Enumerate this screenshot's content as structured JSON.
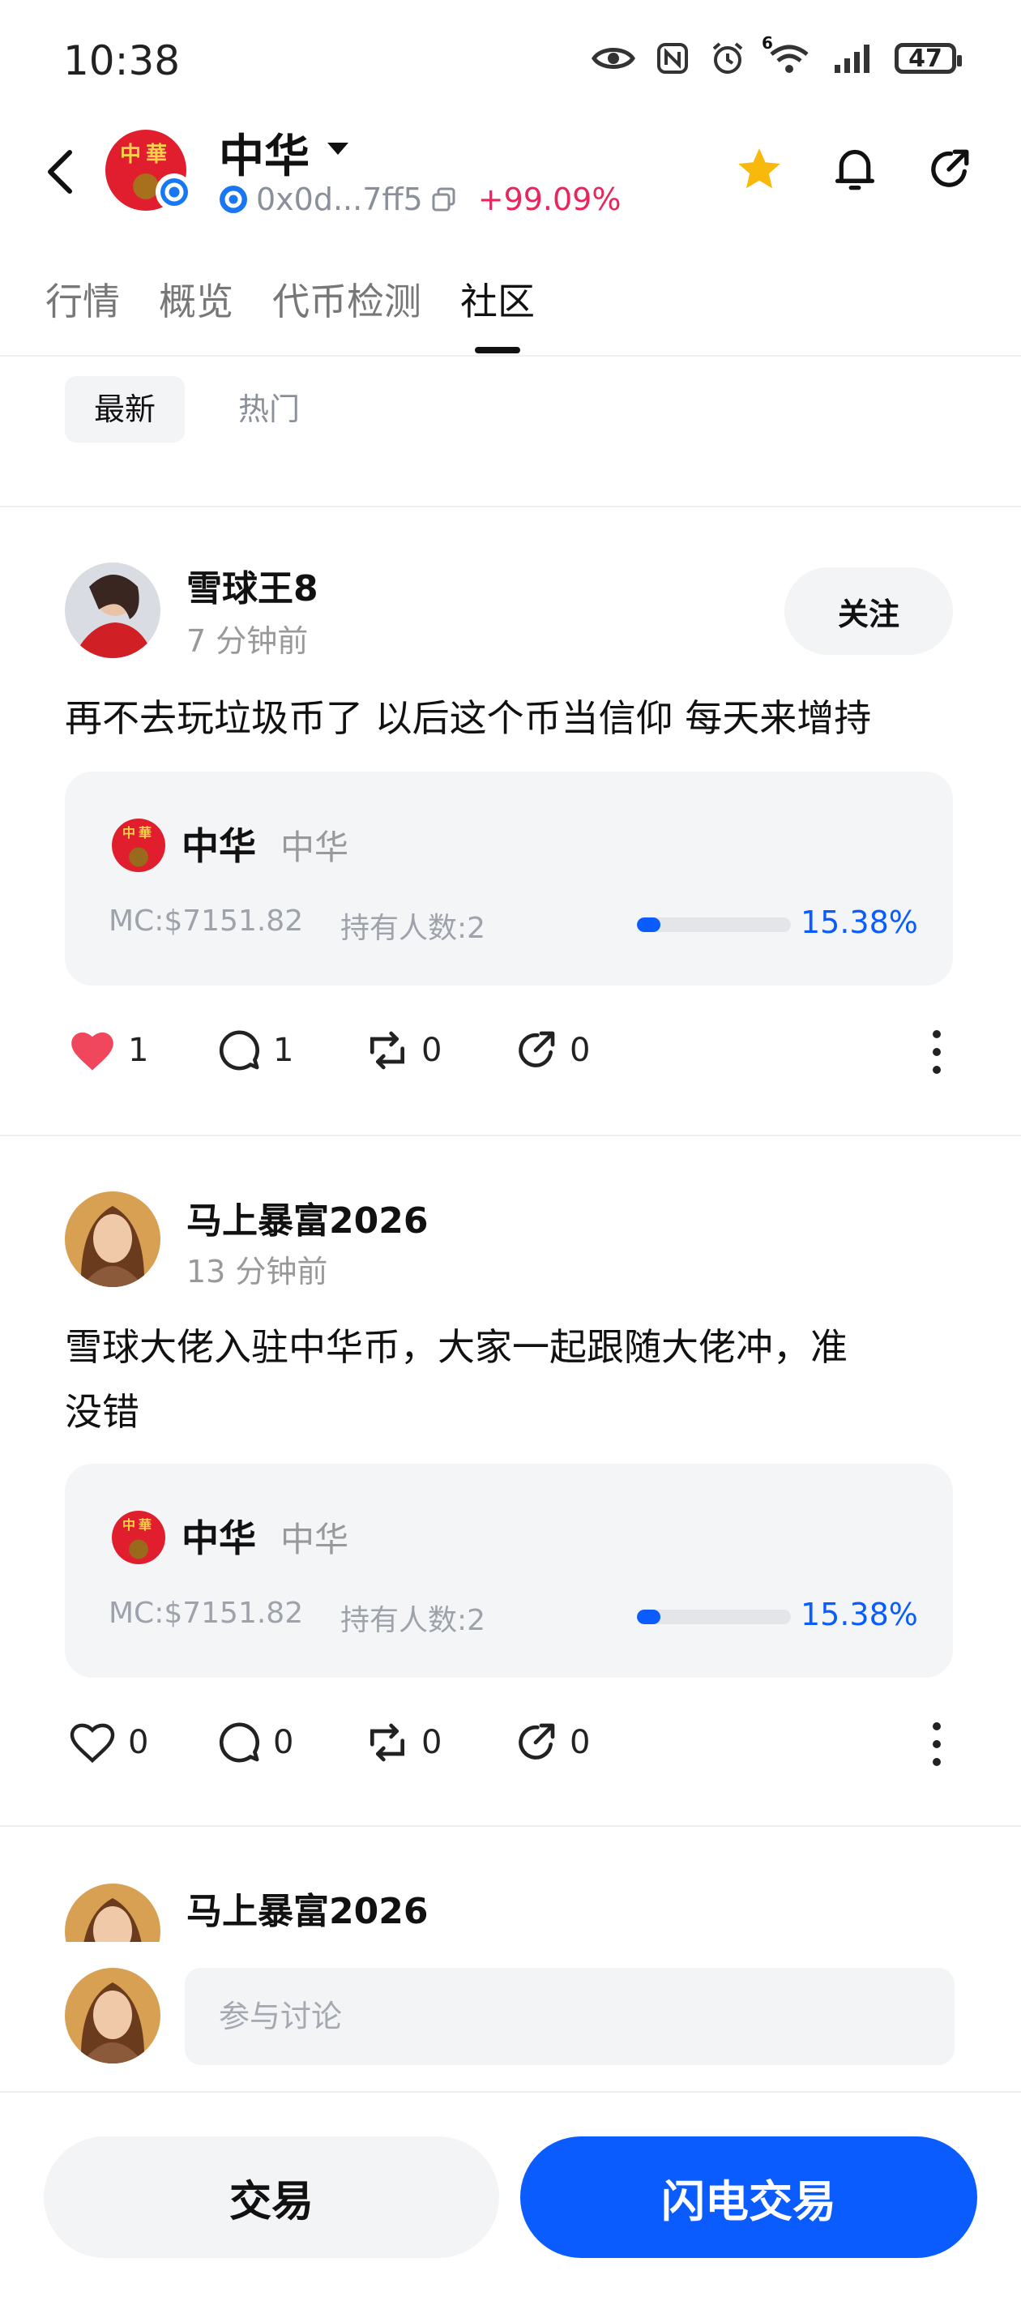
{
  "status_bar": {
    "time": "10:38",
    "battery": "47",
    "wifi_badge": "6"
  },
  "header": {
    "token_name": "中华",
    "address": "0x0d...7ff5",
    "change": "+99.09%",
    "avatar_text": "中華",
    "colors": {
      "positive": "#e8265b",
      "star": "#f8b90c"
    }
  },
  "tabs": [
    {
      "label": "行情",
      "active": false
    },
    {
      "label": "概览",
      "active": false
    },
    {
      "label": "代币检测",
      "active": false
    },
    {
      "label": "社区",
      "active": true
    }
  ],
  "filters": [
    {
      "label": "最新",
      "active": true
    },
    {
      "label": "热门",
      "active": false
    }
  ],
  "posts": [
    {
      "username": "雪球王8",
      "time": "7 分钟前",
      "follow_label": "关注",
      "text": "再不去玩垃圾币了 以后这个币当信仰 每天来增持",
      "card": {
        "name": "中华",
        "symbol": "中华",
        "mc": "MC:$7151.82",
        "holders": "持有人数:2",
        "progress": "15.38%",
        "progress_value": 15.38
      },
      "likes": "1",
      "comments": "1",
      "reposts": "0",
      "shares": "0",
      "liked": true
    },
    {
      "username": "马上暴富2026",
      "time": "13 分钟前",
      "text_line1": "雪球大佬入驻中华币，大家一起跟随大佬冲，准",
      "text_line2": "没错",
      "card": {
        "name": "中华",
        "symbol": "中华",
        "mc": "MC:$7151.82",
        "holders": "持有人数:2",
        "progress": "15.38%",
        "progress_value": 15.38
      },
      "likes": "0",
      "comments": "0",
      "reposts": "0",
      "shares": "0",
      "liked": false
    },
    {
      "username": "马上暴富2026"
    }
  ],
  "comment": {
    "placeholder": "参与讨论"
  },
  "bottom": {
    "trade_label": "交易",
    "flash_trade_label": "闪电交易"
  },
  "colors": {
    "accent": "#0a5cff",
    "like": "#f0475c"
  }
}
